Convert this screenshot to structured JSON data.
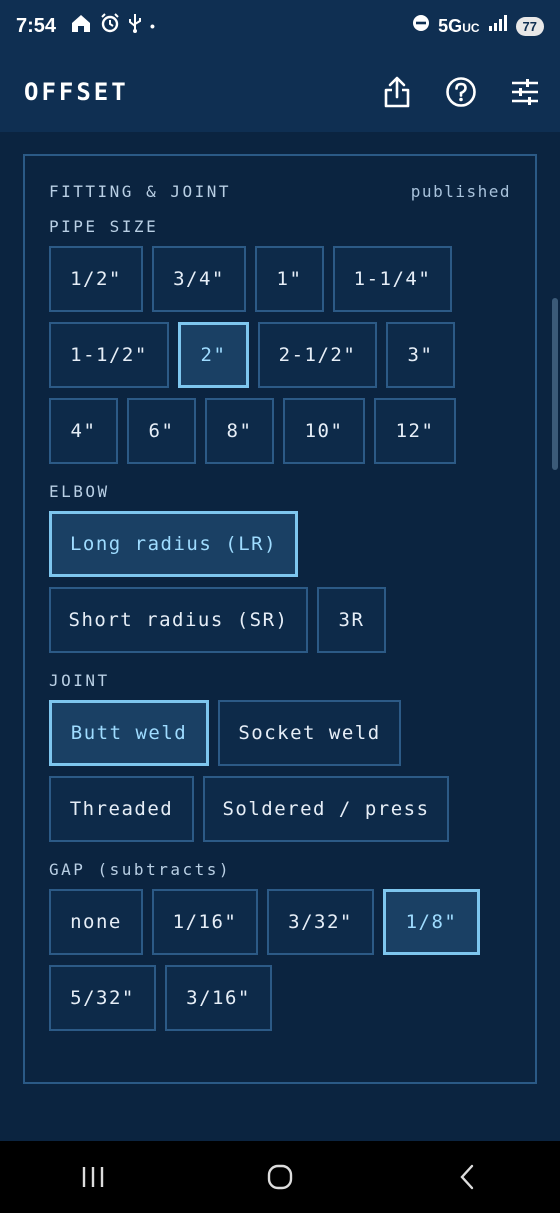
{
  "status_bar": {
    "time": "7:54",
    "network": "5G",
    "network_sub": "UC",
    "battery": "77",
    "dot": "•"
  },
  "header": {
    "title": "OFFSET",
    "icons": [
      "share-icon",
      "help-icon",
      "settings-sliders-icon"
    ]
  },
  "panel": {
    "title": "FITTING & JOINT",
    "status": "published",
    "pipe_size": {
      "label": "PIPE SIZE",
      "rows": [
        [
          "1/2\"",
          "3/4\"",
          "1\"",
          "1-1/4\""
        ],
        [
          "1-1/2\"",
          "2\"",
          "2-1/2\"",
          "3\""
        ],
        [
          "4\"",
          "6\"",
          "8\"",
          "10\"",
          "12\""
        ]
      ],
      "selected": "2\""
    },
    "elbow": {
      "label": "ELBOW",
      "rows": [
        [
          "Long radius (LR)"
        ],
        [
          "Short radius (SR)",
          "3R"
        ]
      ],
      "selected": "Long radius (LR)"
    },
    "joint": {
      "label": "JOINT",
      "rows": [
        [
          "Butt weld",
          "Socket weld"
        ],
        [
          "Threaded",
          "Soldered / press"
        ]
      ],
      "selected": "Butt weld"
    },
    "gap": {
      "label": "GAP (subtracts)",
      "rows": [
        [
          "none",
          "1/16\"",
          "3/32\"",
          "1/8\""
        ],
        [
          "5/32\"",
          "3/16\""
        ]
      ],
      "selected": "1/8\""
    }
  },
  "colors": {
    "background": "#0b2440",
    "header": "#0f2f52",
    "border": "#2c5a86",
    "selected_border": "#7ec6ee",
    "selected_text": "#9fdcff"
  }
}
